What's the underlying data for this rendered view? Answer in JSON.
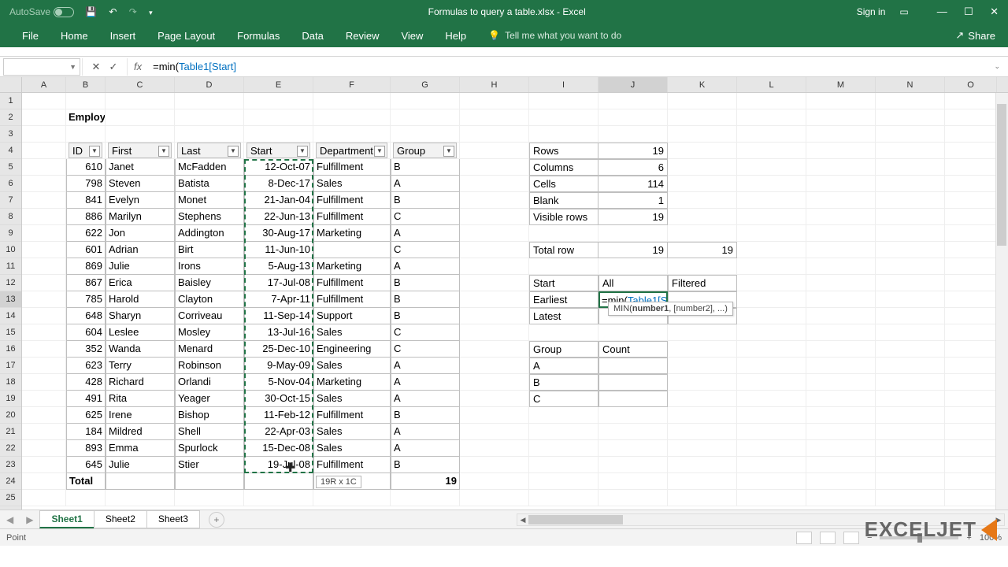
{
  "title": "Formulas to query a table.xlsx  -  Excel",
  "autosave": "AutoSave",
  "signin": "Sign in",
  "share": "Share",
  "tabs": [
    "File",
    "Home",
    "Insert",
    "Page Layout",
    "Formulas",
    "Data",
    "Review",
    "View",
    "Help"
  ],
  "tellme": "Tell me what you want to do",
  "namebox": "",
  "formula": {
    "pre": "=min(",
    "ref": "Table1[Start]",
    "post": ""
  },
  "columns": [
    "A",
    "B",
    "C",
    "D",
    "E",
    "F",
    "G",
    "H",
    "I",
    "J",
    "K",
    "L",
    "M",
    "N",
    "O"
  ],
  "section_title": "Employee data",
  "table_headers": [
    "ID",
    "First",
    "Last",
    "Start",
    "Department",
    "Group"
  ],
  "rows": [
    {
      "id": 610,
      "first": "Janet",
      "last": "McFadden",
      "start": "12-Oct-07",
      "dept": "Fulfillment",
      "grp": "B"
    },
    {
      "id": 798,
      "first": "Steven",
      "last": "Batista",
      "start": "8-Dec-17",
      "dept": "Sales",
      "grp": "A"
    },
    {
      "id": 841,
      "first": "Evelyn",
      "last": "Monet",
      "start": "21-Jan-04",
      "dept": "Fulfillment",
      "grp": "B"
    },
    {
      "id": 886,
      "first": "Marilyn",
      "last": "Stephens",
      "start": "22-Jun-13",
      "dept": "Fulfillment",
      "grp": "C"
    },
    {
      "id": 622,
      "first": "Jon",
      "last": "Addington",
      "start": "30-Aug-17",
      "dept": "Marketing",
      "grp": "A"
    },
    {
      "id": 601,
      "first": "Adrian",
      "last": "Birt",
      "start": "11-Jun-10",
      "dept": "",
      "grp": "C"
    },
    {
      "id": 869,
      "first": "Julie",
      "last": "Irons",
      "start": "5-Aug-13",
      "dept": "Marketing",
      "grp": "A"
    },
    {
      "id": 867,
      "first": "Erica",
      "last": "Baisley",
      "start": "17-Jul-08",
      "dept": "Fulfillment",
      "grp": "B"
    },
    {
      "id": 785,
      "first": "Harold",
      "last": "Clayton",
      "start": "7-Apr-11",
      "dept": "Fulfillment",
      "grp": "B"
    },
    {
      "id": 648,
      "first": "Sharyn",
      "last": "Corriveau",
      "start": "11-Sep-14",
      "dept": "Support",
      "grp": "B"
    },
    {
      "id": 604,
      "first": "Leslee",
      "last": "Mosley",
      "start": "13-Jul-16",
      "dept": "Sales",
      "grp": "C"
    },
    {
      "id": 352,
      "first": "Wanda",
      "last": "Menard",
      "start": "25-Dec-10",
      "dept": "Engineering",
      "grp": "C"
    },
    {
      "id": 623,
      "first": "Terry",
      "last": "Robinson",
      "start": "9-May-09",
      "dept": "Sales",
      "grp": "A"
    },
    {
      "id": 428,
      "first": "Richard",
      "last": "Orlandi",
      "start": "5-Nov-04",
      "dept": "Marketing",
      "grp": "A"
    },
    {
      "id": 491,
      "first": "Rita",
      "last": "Yeager",
      "start": "30-Oct-15",
      "dept": "Sales",
      "grp": "A"
    },
    {
      "id": 625,
      "first": "Irene",
      "last": "Bishop",
      "start": "11-Feb-12",
      "dept": "Fulfillment",
      "grp": "B"
    },
    {
      "id": 184,
      "first": "Mildred",
      "last": "Shell",
      "start": "22-Apr-03",
      "dept": "Sales",
      "grp": "A"
    },
    {
      "id": 893,
      "first": "Emma",
      "last": "Spurlock",
      "start": "15-Dec-08",
      "dept": "Sales",
      "grp": "A"
    },
    {
      "id": 645,
      "first": "Julie",
      "last": "Stier",
      "start": "19-Jul-08",
      "dept": "Fulfillment",
      "grp": "B"
    }
  ],
  "total_label": "Total",
  "total_value": 19,
  "stats": {
    "rows_l": "Rows",
    "rows_v": 19,
    "cols_l": "Columns",
    "cols_v": 6,
    "cells_l": "Cells",
    "cells_v": 114,
    "blank_l": "Blank",
    "blank_v": 1,
    "vis_l": "Visible rows",
    "vis_v": 19,
    "totr_l": "Total row",
    "totr_v1": 19,
    "totr_v2": 19
  },
  "startblock": {
    "h1": "Start",
    "h2": "All",
    "h3": "Filtered",
    "r1": "Earliest",
    "r2": "Latest",
    "editing_pre": "=min(",
    "editing_ref": "Table1[Start]",
    "editing_post": ""
  },
  "tooltip": {
    "fn": "MIN(",
    "b": "number1",
    ", [number2], ...)": ""
  },
  "tooltip_text": "MIN(number1, [number2], ...)",
  "groupblock": {
    "h1": "Group",
    "h2": "Count",
    "a": "A",
    "b": "B",
    "c": "C"
  },
  "sel_hint": "19R x 1C",
  "sheets": [
    "Sheet1",
    "Sheet2",
    "Sheet3"
  ],
  "mode": "Point",
  "zoom": "100%",
  "watermark": "EXCELJET"
}
